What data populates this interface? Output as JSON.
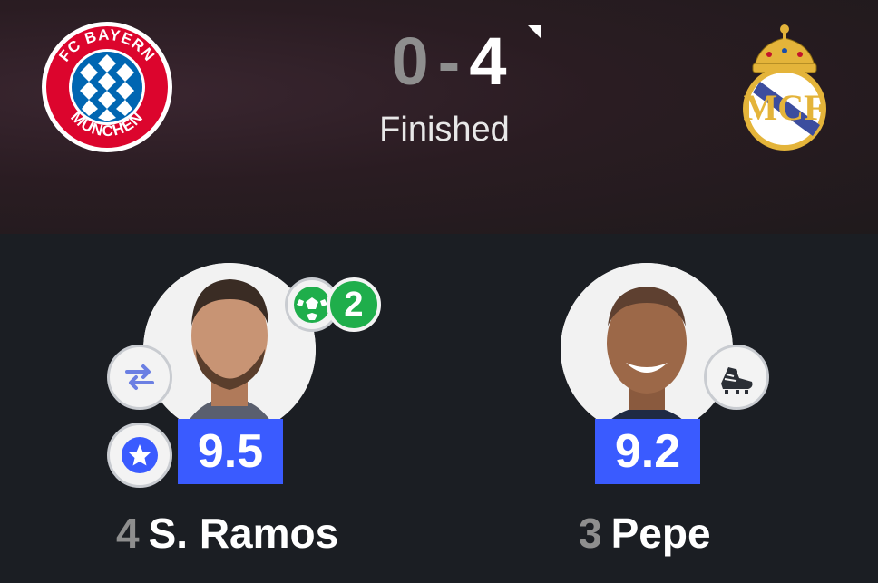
{
  "match": {
    "home_team": {
      "crest_text_top": "FC BAYERN",
      "crest_text_bottom": "MÜNCHEN",
      "icon": "fc-bayern-crest"
    },
    "away_team": {
      "icon": "real-madrid-crest"
    },
    "score_home": "0",
    "score_separator": "-",
    "score_away": "4",
    "status": "Finished"
  },
  "players": [
    {
      "number": "4",
      "name": "S. Ramos",
      "rating": "9.5",
      "goals": "2",
      "icons": [
        "soccer-ball-icon",
        "substitution-icon",
        "star-icon"
      ]
    },
    {
      "number": "3",
      "name": "Pepe",
      "rating": "9.2",
      "icons": [
        "football-boot-icon"
      ]
    }
  ],
  "colors": {
    "rating_bg": "#3a5bff",
    "goal_badge": "#1fae4b",
    "background": "#1b1e23"
  }
}
